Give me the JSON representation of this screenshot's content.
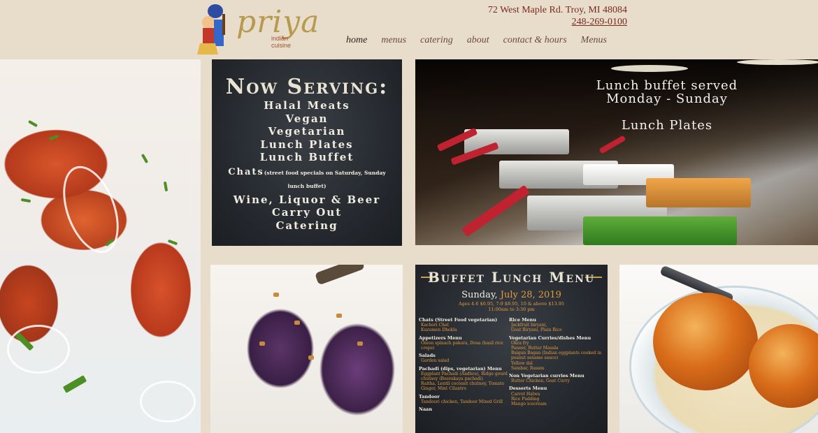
{
  "header": {
    "logo_text": "priya",
    "logo_subtext": "indian cuisine",
    "address": "72 West Maple Rd. Troy, MI 48084",
    "phone": "248-269-0100"
  },
  "nav": {
    "items": [
      {
        "label": "home"
      },
      {
        "label": "menus"
      },
      {
        "label": "catering"
      },
      {
        "label": "about"
      },
      {
        "label": "contact & hours"
      },
      {
        "label": "Menus"
      }
    ]
  },
  "now_serving": {
    "title": "Now Serving:",
    "items": [
      "Halal Meats",
      "Vegan",
      "Vegetarian",
      "Lunch Plates",
      "Lunch Buffet"
    ],
    "chats": "Chats",
    "chats_note": "(street food specials on Saturday, Sunday",
    "chats_note_2": "lunch buffet)",
    "items2": [
      "Wine, Liquor & Beer",
      "Carry Out",
      "Catering"
    ]
  },
  "buffet_banner": {
    "line1": "Lunch buffet served",
    "line2": "Monday - Sunday",
    "line3": "Lunch Plates"
  },
  "menu_board": {
    "title": "Buffet Lunch Menu",
    "day": "Sunday,",
    "date": "July 28, 2019",
    "prices": "Ages 4-6 $6.95, 7-9 $8.95, 10 & above $13.95",
    "hours": "11:00am to 3:30 pm",
    "left": [
      {
        "heading": "Chats (Street Food vegetarian)",
        "items": [
          "Kachori Chat",
          "Kuzumen Dhokla"
        ]
      },
      {
        "heading": "Appetizers Menu",
        "items": [
          "Onion spinach pakora, Dosa (basil rice crepe)"
        ]
      },
      {
        "heading": "Salads",
        "items": [
          "Garden salad"
        ]
      },
      {
        "heading": "Pachadi (dips, vegetarian) Menu",
        "items": [
          "Eggplant Pachadi (Andhra), Ridge gourd chutney (Beerakaya pachadi)",
          "Raitha, Lentil coconut chutney, Tomato Ginger, Mint Cilantro"
        ]
      },
      {
        "heading": "Tandoor",
        "items": [
          "Tandoori chicken, Tandoor Mixed Grill"
        ]
      },
      {
        "heading": "Naan",
        "items": []
      }
    ],
    "right": [
      {
        "heading": "Rice Menu",
        "items": [
          "Jackfruit biryani,",
          "Goat Biryani, Plain Rice"
        ]
      },
      {
        "heading": "Vegetarian Curries/dishes Menu",
        "items": [
          "Okra fry",
          "Paneer, Butter Masala",
          "Baigan Bagan (Indian eggplants cooked in peanut sesame sauce)",
          "Yellow dal",
          "Sambar, Rasam"
        ]
      },
      {
        "heading": "Non Vegetarian curries Menu",
        "items": [
          "Butter Chicken, Goat Curry"
        ]
      },
      {
        "heading": "Desserts Menu",
        "items": [
          "Carrot Halwa",
          "Rice Pudding",
          "Mango icecream"
        ]
      }
    ]
  }
}
